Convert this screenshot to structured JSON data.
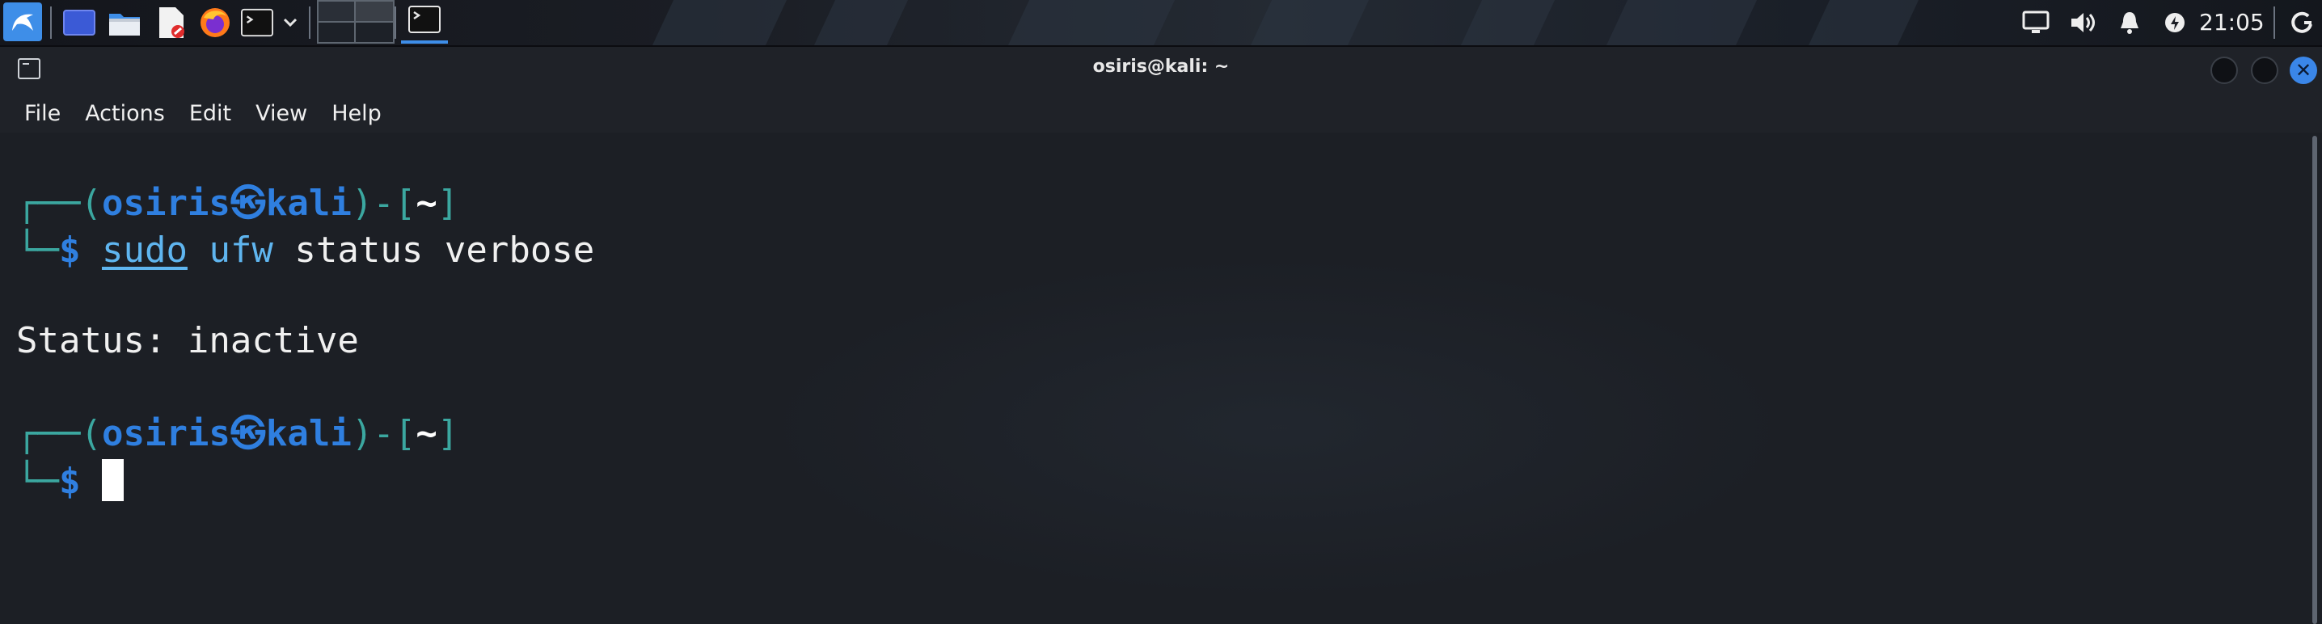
{
  "taskbar": {
    "launchers": [
      {
        "icon": "kali-menu-icon"
      },
      {
        "icon": "show-desktop-icon"
      },
      {
        "icon": "file-manager-icon"
      },
      {
        "icon": "text-editor-icon"
      },
      {
        "icon": "firefox-icon"
      },
      {
        "icon": "terminal-icon"
      },
      {
        "icon": "chevron-down-icon"
      }
    ],
    "workspaces": 4,
    "active_task_icon": "terminal-icon",
    "tray_icons": [
      "display-icon",
      "volume-icon",
      "notification-bell-icon",
      "power-manager-icon"
    ],
    "clock": "21:05",
    "session_icon": "power-icon",
    "accent": "#3e8ee8"
  },
  "window": {
    "title": "osiris@kali: ~",
    "icon": "terminal-icon",
    "controls": {
      "minimize": "minimize-button",
      "maximize": "maximize-button",
      "close": "close-icon"
    },
    "close_symbol": "✕"
  },
  "menubar": {
    "items": [
      "File",
      "Actions",
      "Edit",
      "View",
      "Help"
    ]
  },
  "terminal": {
    "prompt_open": "┌──(",
    "user": "osiris",
    "at_symbol": "㉿",
    "host": "kali",
    "prompt_mid": ")-[",
    "cwd": "~",
    "prompt_close": "]",
    "prompt_corner": "└─",
    "prompt_dollar": "$",
    "command": {
      "sudo": "sudo",
      "bin": "ufw",
      "args": " status verbose"
    },
    "output": "Status: inactive",
    "colors": {
      "prompt": "#3ba7a0",
      "user_host": "#2f7fe0",
      "command": "#5fb5ef",
      "text": "#f0f0f0",
      "background": "#1c1f25"
    }
  }
}
